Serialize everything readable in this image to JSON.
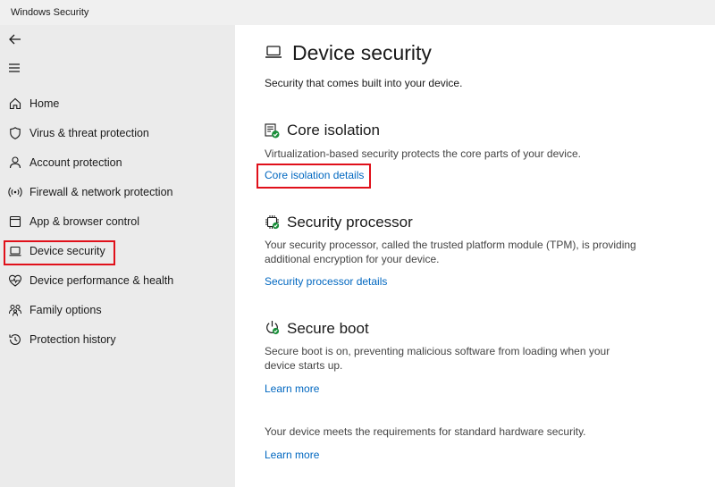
{
  "window": {
    "title": "Windows Security"
  },
  "sidebar": {
    "items": [
      {
        "label": "Home",
        "icon": "home-icon"
      },
      {
        "label": "Virus & threat protection",
        "icon": "shield-icon"
      },
      {
        "label": "Account protection",
        "icon": "person-icon"
      },
      {
        "label": "Firewall & network protection",
        "icon": "wireless-icon"
      },
      {
        "label": "App & browser control",
        "icon": "app-window-icon"
      },
      {
        "label": "Device security",
        "icon": "laptop-icon",
        "selected": true
      },
      {
        "label": "Device performance & health",
        "icon": "heart-pulse-icon"
      },
      {
        "label": "Family options",
        "icon": "family-icon"
      },
      {
        "label": "Protection history",
        "icon": "history-icon"
      }
    ]
  },
  "main": {
    "title": "Device security",
    "subtitle": "Security that comes built into your device.",
    "sections": [
      {
        "title": "Core isolation",
        "icon": "core-isolation-icon",
        "description": "Virtualization-based security protects the core parts of your device.",
        "link": "Core isolation details"
      },
      {
        "title": "Security processor",
        "icon": "chip-icon",
        "description": "Your security processor, called the trusted platform module (TPM), is providing additional encryption for your device.",
        "link": "Security processor details"
      },
      {
        "title": "Secure boot",
        "icon": "power-icon",
        "description": "Secure boot is on, preventing malicious software from loading when your device starts up.",
        "link": "Learn more"
      }
    ],
    "footer_text": "Your device meets the requirements for standard hardware security.",
    "footer_link": "Learn more"
  },
  "colors": {
    "accent": "#0067c0",
    "highlight": "#e0101a",
    "sidebar_bg": "#ebebeb",
    "check_green": "#1a8f3a"
  }
}
